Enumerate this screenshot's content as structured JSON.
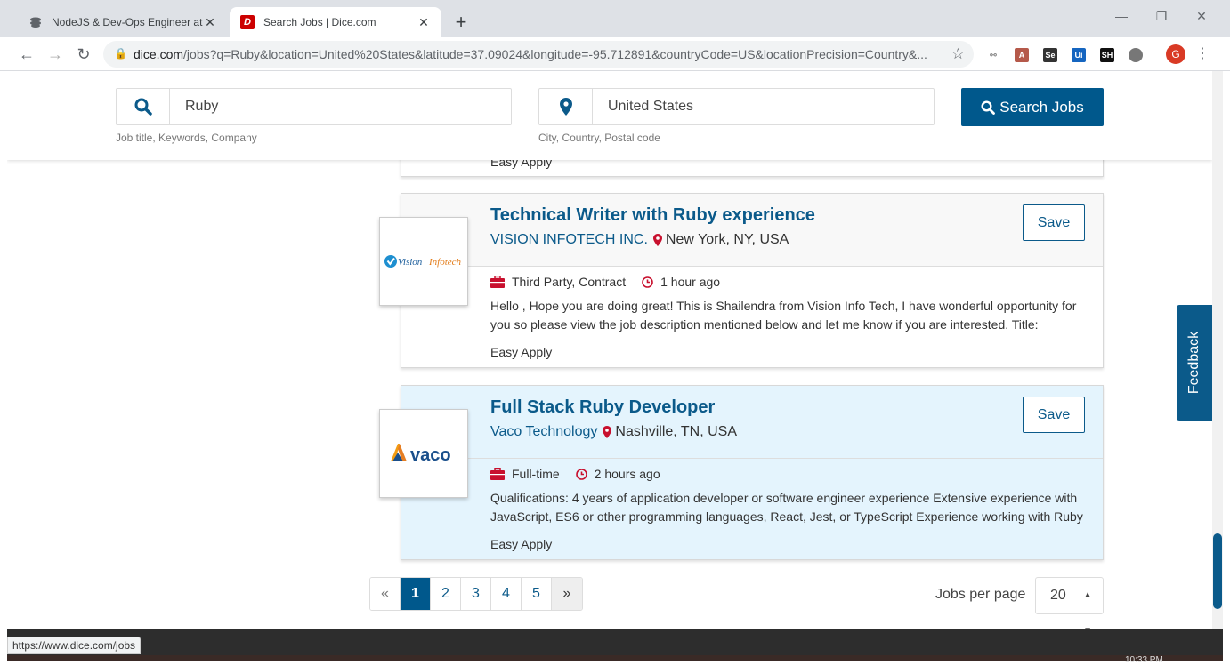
{
  "browser": {
    "tabs": [
      {
        "title": "NodeJS & Dev-Ops Engineer at S",
        "active": false
      },
      {
        "title": "Search Jobs | Dice.com",
        "active": true
      }
    ],
    "new_tab": "+",
    "url_host": "dice.com",
    "url_path": "/jobs?q=Ruby&location=United%20States&latitude=37.09024&longitude=-95.712891&countryCode=US&locationPrecision=Country&...",
    "profile_initial": "G",
    "status_url": "https://www.dice.com/jobs",
    "clock": "10:33 PM"
  },
  "search": {
    "keyword": "Ruby",
    "keyword_help": "Job title, Keywords, Company",
    "location": "United States",
    "location_help": "City, Country, Postal code",
    "button": "Search Jobs"
  },
  "partial_card": {
    "easy_apply": "Easy Apply"
  },
  "jobs": [
    {
      "title": "Technical Writer with Ruby experience",
      "company": "VISION INFOTECH INC.",
      "location": "New York, NY, USA",
      "save": "Save",
      "employment": "Third Party, Contract",
      "posted": "1 hour ago",
      "description": "Hello , Hope you are doing great! This is Shailendra from Vision Info Tech, I have wonderful opportunity for you so please view the job description mentioned below and let me know if you are interested. Title:",
      "easy_apply": "Easy Apply",
      "logo_text_1": "Vision",
      "logo_text_2": "Infotech"
    },
    {
      "title": "Full Stack Ruby Developer",
      "company": "Vaco Technology",
      "location": "Nashville, TN, USA",
      "save": "Save",
      "employment": "Full-time",
      "posted": "2 hours ago",
      "description": "Qualifications: 4 years of application developer or software engineer experience Extensive experience with JavaScript, ES6 or other programming languages, React, Jest, or TypeScript Experience working with Ruby",
      "easy_apply": "Easy Apply",
      "logo_text": "vaco"
    }
  ],
  "pagination": {
    "prev": "«",
    "pages": [
      "1",
      "2",
      "3",
      "4",
      "5"
    ],
    "current": "1",
    "next": "»",
    "per_page_label": "Jobs per page",
    "per_page_value": "20"
  },
  "feedback": "Feedback",
  "colors": {
    "brand": "#00588c",
    "title": "#0b5a8a",
    "highlight": "#e4f4fd",
    "pin": "#c8102e"
  }
}
